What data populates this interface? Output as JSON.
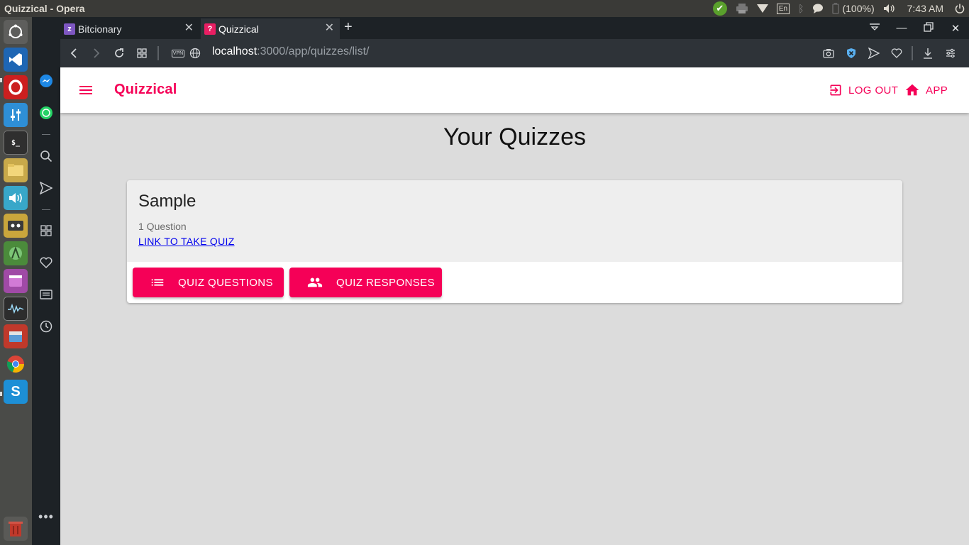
{
  "os": {
    "window_title": "Quizzical - Opera",
    "keyboard": "En",
    "battery": "(100%)",
    "time": "7:43 AM"
  },
  "browser": {
    "tabs": [
      {
        "label": "Bitcionary",
        "favicon_color": "#7e57c2"
      },
      {
        "label": "Quizzical",
        "favicon_color": "#e91e63"
      }
    ],
    "url_host": "localhost",
    "url_path": ":3000/app/quizzes/list/",
    "vpn_label": "VPN"
  },
  "app": {
    "brand": "Quizzical",
    "accent_color": "#f50057",
    "logout_label": "LOG OUT",
    "app_label": "APP",
    "page_title": "Your Quizzes",
    "quizzes": [
      {
        "name": "Sample",
        "question_count": "1 Question",
        "link_label": "LINK TO TAKE QUIZ",
        "questions_button": "QUIZ QUESTIONS",
        "responses_button": "QUIZ RESPONSES"
      }
    ]
  }
}
